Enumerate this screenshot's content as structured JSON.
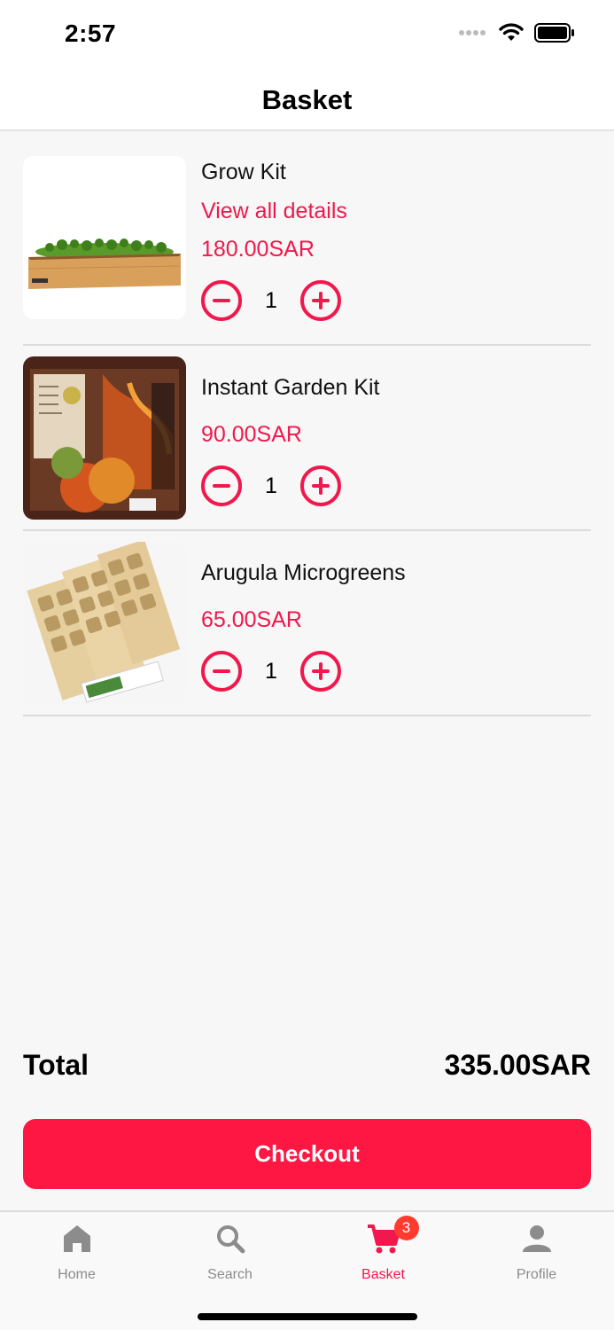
{
  "status_bar": {
    "time": "2:57"
  },
  "header": {
    "title": "Basket"
  },
  "items": [
    {
      "name": "Grow Kit",
      "details_link": "View all details",
      "price": "180.00SAR",
      "quantity": "1"
    },
    {
      "name": "Instant Garden Kit",
      "price": "90.00SAR",
      "quantity": "1"
    },
    {
      "name": "Arugula Microgreens",
      "price": "65.00SAR",
      "quantity": "1"
    }
  ],
  "summary": {
    "total_label": "Total",
    "total_value": "335.00SAR"
  },
  "checkout": {
    "label": "Checkout"
  },
  "tabs": [
    {
      "label": "Home",
      "icon": "home-icon"
    },
    {
      "label": "Search",
      "icon": "search-icon"
    },
    {
      "label": "Basket",
      "icon": "cart-icon",
      "badge": "3",
      "active": true
    },
    {
      "label": "Profile",
      "icon": "person-icon"
    }
  ],
  "colors": {
    "accent": "#f0184c",
    "button": "#ff1744",
    "badge": "#ff3b30"
  }
}
